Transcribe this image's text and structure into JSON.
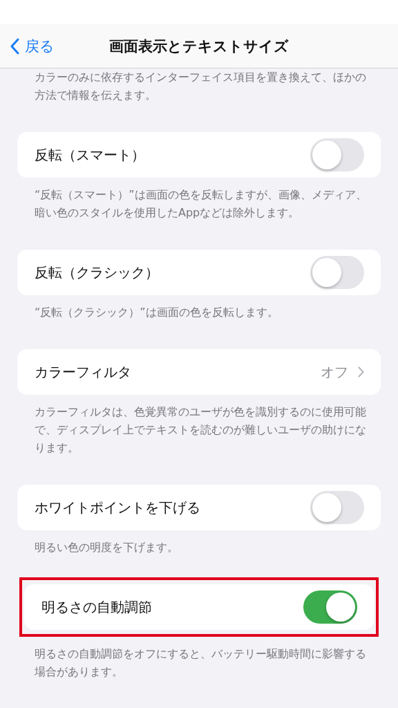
{
  "nav": {
    "back": "戻る",
    "title": "画面表示とテキストサイズ"
  },
  "top_note": "カラーのみに依存するインターフェイス項目を置き換えて、ほかの方法で情報を伝えます。",
  "sections": [
    {
      "kind": "toggle",
      "label": "反転（スマート）",
      "on": false,
      "highlighted": false,
      "footer": "“反転（スマート）”は画面の色を反転しますが、画像、メディア、暗い色のスタイルを使用したAppなどは除外します。"
    },
    {
      "kind": "toggle",
      "label": "反転（クラシック）",
      "on": false,
      "highlighted": false,
      "footer": "“反転（クラシック）”は画面の色を反転します。"
    },
    {
      "kind": "disclosure",
      "label": "カラーフィルタ",
      "value": "オフ",
      "highlighted": false,
      "footer": "カラーフィルタは、色覚異常のユーザが色を識別するのに使用可能で、ディスプレイ上でテキストを読むのが難しいユーザの助けになります。"
    },
    {
      "kind": "toggle",
      "label": "ホワイトポイントを下げる",
      "on": false,
      "highlighted": false,
      "footer": "明るい色の明度を下げます。"
    },
    {
      "kind": "toggle",
      "label": "明るさの自動調節",
      "on": true,
      "highlighted": true,
      "footer": "明るさの自動調節をオフにすると、バッテリー駆動時間に影響する場合があります。"
    }
  ]
}
